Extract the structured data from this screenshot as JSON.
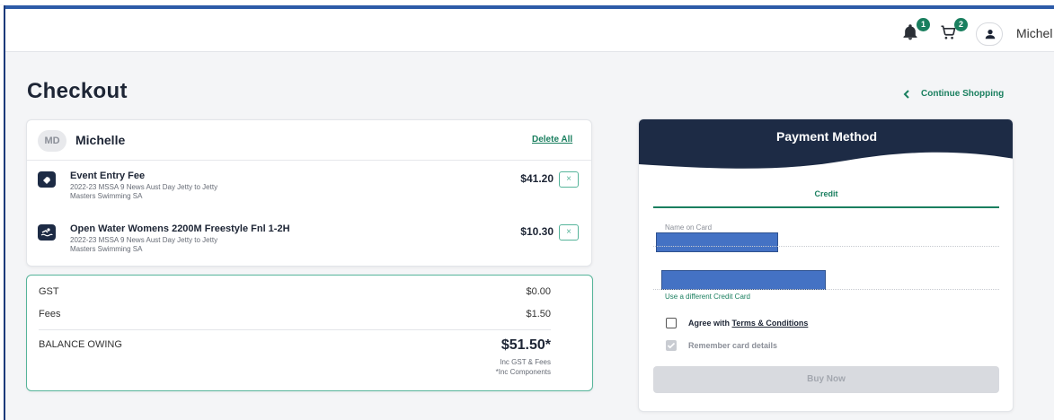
{
  "topbar": {
    "notifications_count": "1",
    "cart_count": "2",
    "username": "Michel"
  },
  "page": {
    "title": "Checkout",
    "continue_label": "Continue Shopping"
  },
  "cart": {
    "initials": "MD",
    "name": "Michelle",
    "delete_all": "Delete All",
    "items": [
      {
        "title": "Event Entry Fee",
        "line1": "2022-23 MSSA 9 News Aust Day Jetty to Jetty",
        "line2": "Masters Swimming SA",
        "price": "$41.20",
        "remove": "×"
      },
      {
        "title": "Open Water Womens 2200M Freestyle Fnl 1-2H",
        "line1": "2022-23 MSSA 9 News Aust Day Jetty to Jetty",
        "line2": "Masters Swimming SA",
        "price": "$10.30",
        "remove": "×"
      }
    ]
  },
  "summary": {
    "gst_label": "GST",
    "gst_value": "$0.00",
    "fees_label": "Fees",
    "fees_value": "$1.50",
    "balance_label": "BALANCE OWING",
    "balance_value": "$51.50*",
    "note1": "Inc GST & Fees",
    "note2": "*Inc Components"
  },
  "payment": {
    "title": "Payment Method",
    "tab": "Credit",
    "name_label": "Name on Card",
    "different_card": "Use a different Credit Card",
    "agree_prefix": "Agree with ",
    "terms": "Terms & Conditions",
    "remember": "Remember card details",
    "buy_now": "Buy Now"
  },
  "colors": {
    "brand_navy": "#1d2b45",
    "accent_green": "#1a7f5f",
    "redaction_blue": "#4472c4"
  }
}
